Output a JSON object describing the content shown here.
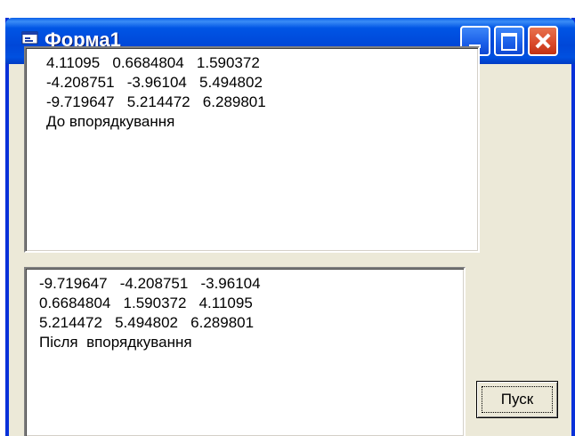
{
  "window": {
    "title": "Форма1",
    "icon": "form-app-icon",
    "controls": {
      "minimize": "minimize-icon",
      "maximize": "maximize-icon",
      "close": "close-icon"
    }
  },
  "list_before": {
    "lines": [
      "4.11095   0.6684804   1.590372",
      "-4.208751   -3.96104   5.494802",
      "-9.719647   5.214472   6.289801",
      "До впорядкування"
    ]
  },
  "list_after": {
    "lines": [
      "-9.719647   -4.208751   -3.96104",
      "0.6684804   1.590372   4.11095",
      "5.214472   5.494802   6.289801",
      "Після  впорядкування"
    ]
  },
  "buttons": {
    "run_label": "Пуск"
  },
  "colors": {
    "titlebar": "#0055e5",
    "close_button": "#d9492a",
    "window_face": "#ece9d8"
  }
}
